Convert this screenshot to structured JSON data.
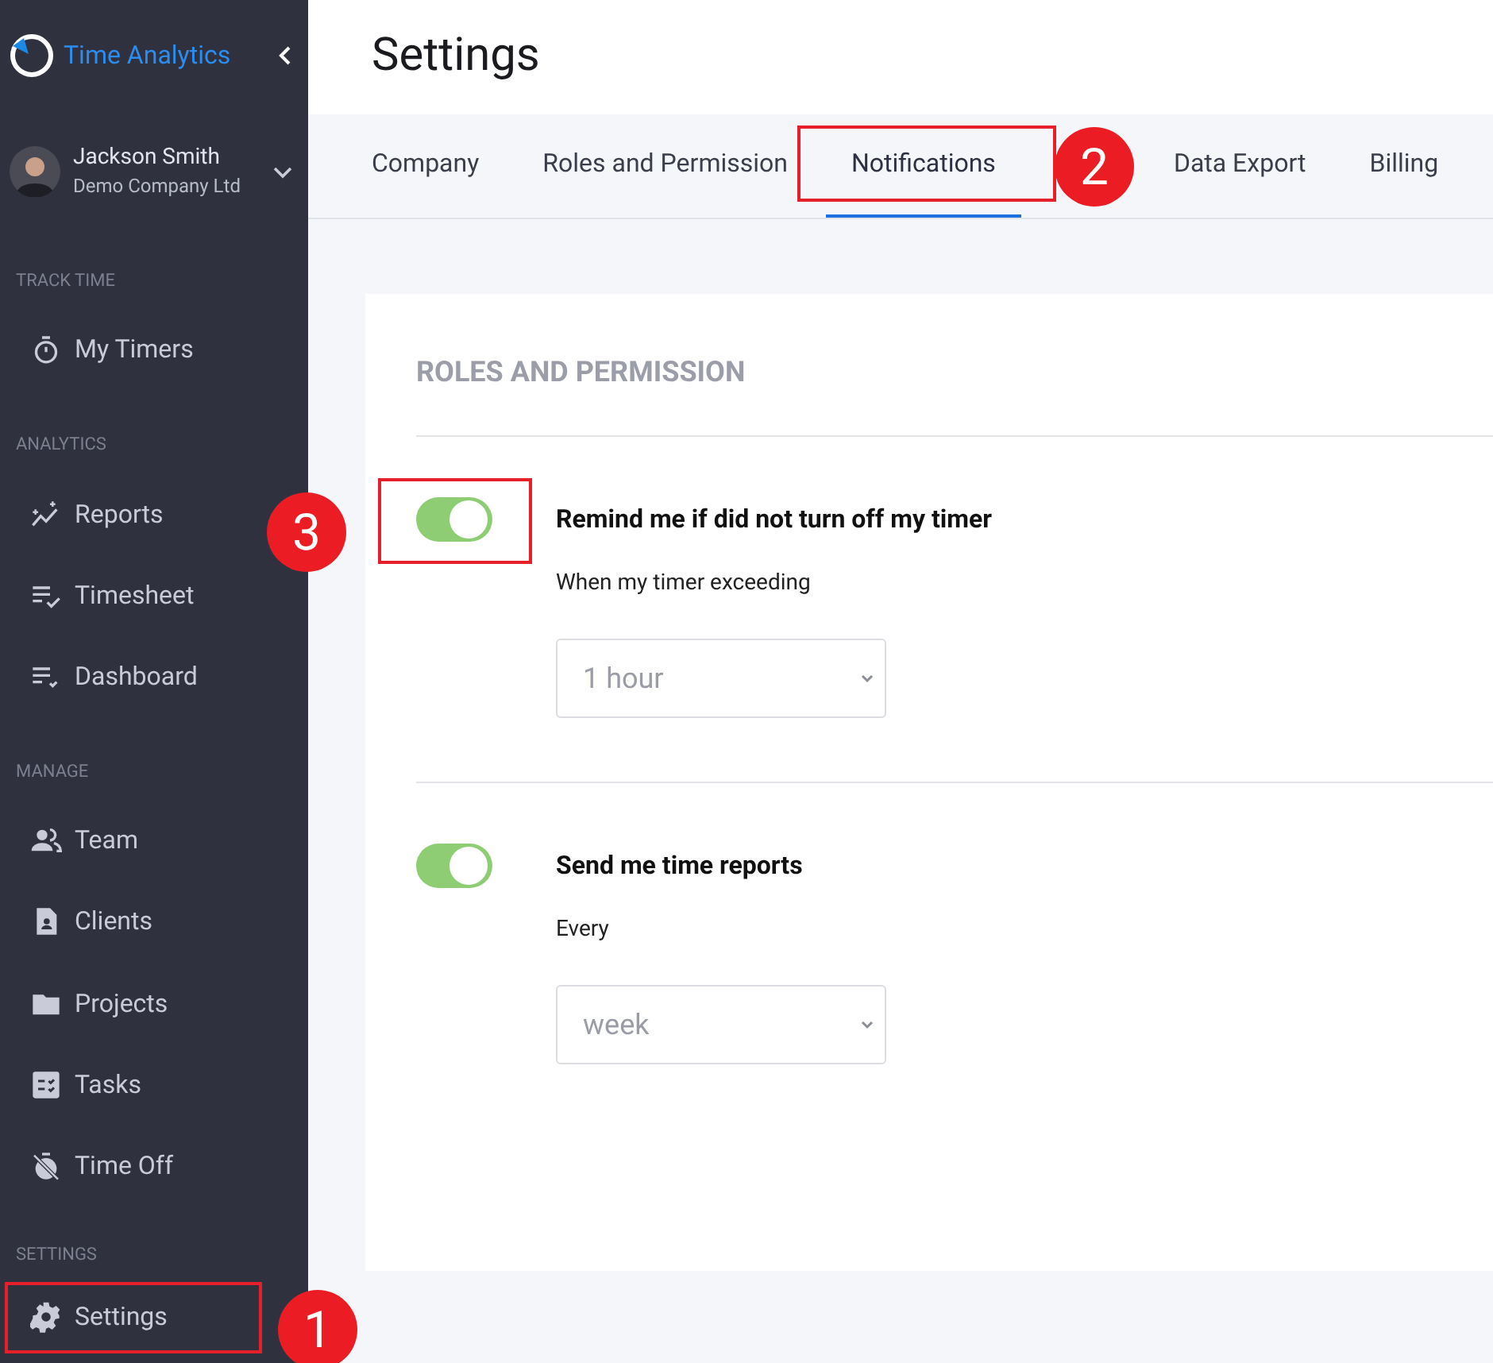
{
  "sidebar": {
    "app_name": "Time Analytics",
    "user": {
      "name": "Jackson Smith",
      "company": "Demo Company Ltd"
    },
    "sections": [
      {
        "header": "TRACK TIME",
        "items": [
          {
            "label": "My Timers",
            "highlighted": false
          }
        ]
      },
      {
        "header": "ANALYTICS",
        "items": [
          {
            "label": "Reports",
            "highlighted": false
          },
          {
            "label": "Timesheet",
            "highlighted": false
          },
          {
            "label": "Dashboard",
            "highlighted": false
          }
        ]
      },
      {
        "header": "MANAGE",
        "items": [
          {
            "label": "Team",
            "highlighted": false
          },
          {
            "label": "Clients",
            "highlighted": false
          },
          {
            "label": "Projects",
            "highlighted": false
          },
          {
            "label": "Tasks",
            "highlighted": false
          },
          {
            "label": "Time Off",
            "highlighted": false
          }
        ]
      },
      {
        "header": "SETTINGS",
        "items": [
          {
            "label": "Settings",
            "highlighted": true
          }
        ]
      }
    ]
  },
  "page_title": "Settings",
  "tabs": [
    {
      "label": "Company",
      "selected": false,
      "highlighted": false
    },
    {
      "label": "Roles and Permission",
      "selected": false,
      "highlighted": false
    },
    {
      "label": "Notifications",
      "selected": true,
      "highlighted": true
    },
    {
      "label": "Data Export",
      "selected": false,
      "highlighted": false
    },
    {
      "label": "Billing",
      "selected": false,
      "highlighted": false
    }
  ],
  "card": {
    "heading": "ROLES AND PERMISSION",
    "settings": [
      {
        "title": "Remind me if did not turn off my timer",
        "on": true,
        "highlighted": true,
        "field_label": "When my timer exceeding",
        "value": "1 hour"
      },
      {
        "title": "Send me time reports",
        "on": true,
        "highlighted": false,
        "field_label": "Every",
        "value": "week"
      }
    ]
  },
  "callouts": [
    {
      "number": "1"
    },
    {
      "number": "2"
    },
    {
      "number": "3"
    }
  ]
}
